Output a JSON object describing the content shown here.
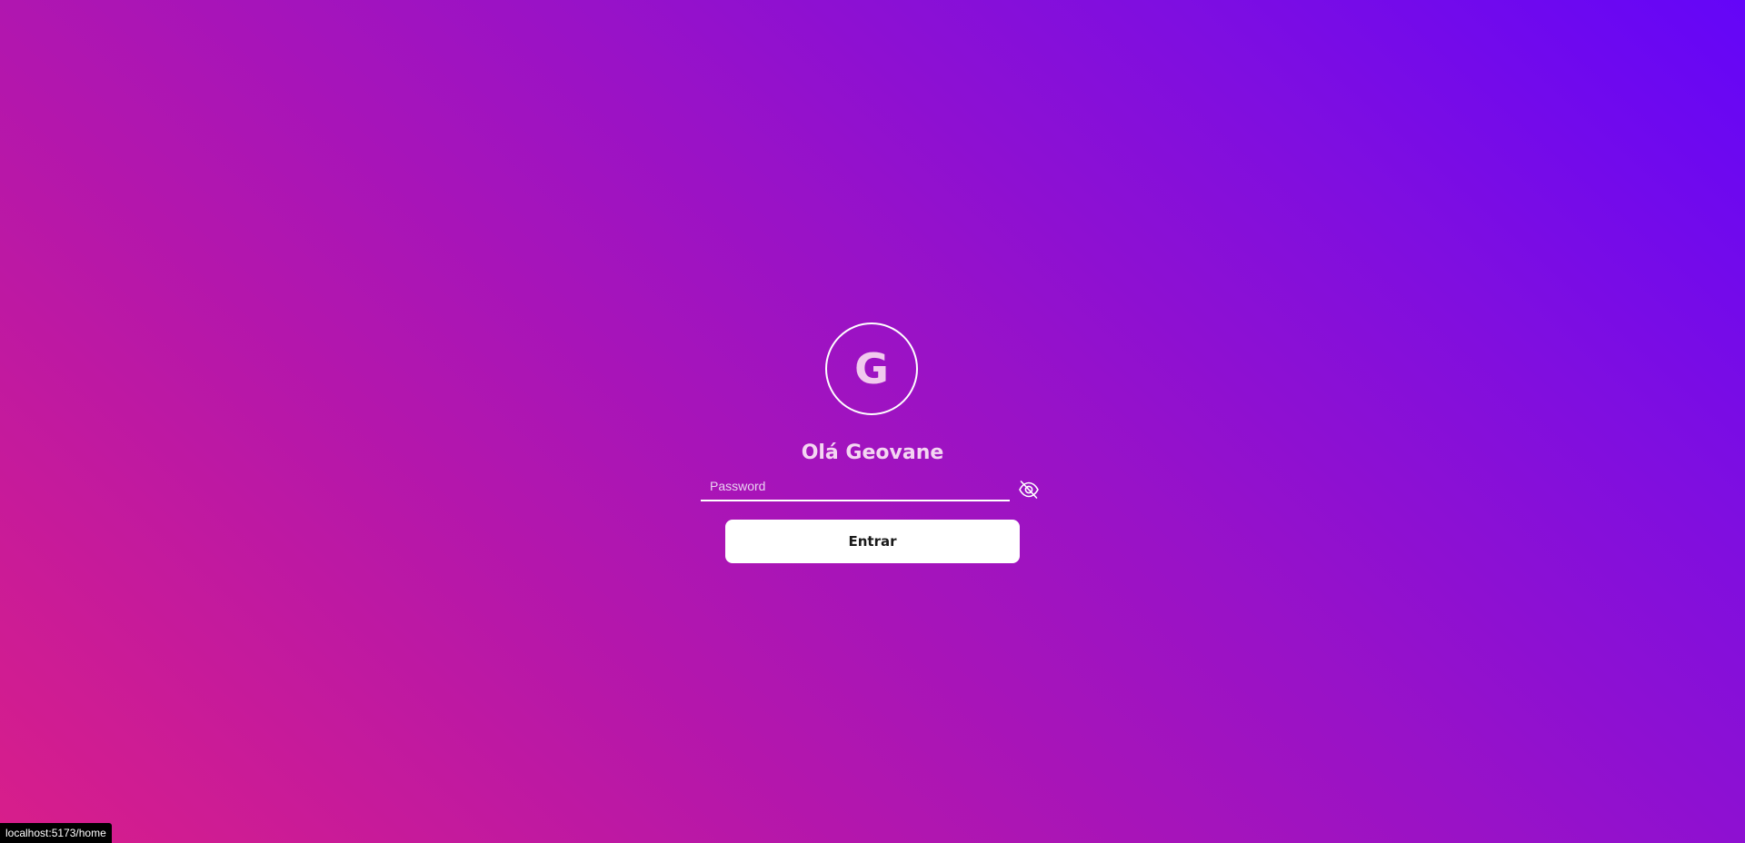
{
  "profile": {
    "avatar_letter": "G",
    "greeting": "Olá Geovane"
  },
  "password": {
    "placeholder": "Password",
    "value": "",
    "toggle_icon": "eye-off-icon"
  },
  "login": {
    "button_label": "Entrar"
  },
  "status_bar": {
    "url": "localhost:5173/home"
  },
  "colors": {
    "gradient_start": "#d81e8a",
    "gradient_end": "#6405f8",
    "button_bg": "#ffffff",
    "text_light": "#f4d6f2"
  }
}
